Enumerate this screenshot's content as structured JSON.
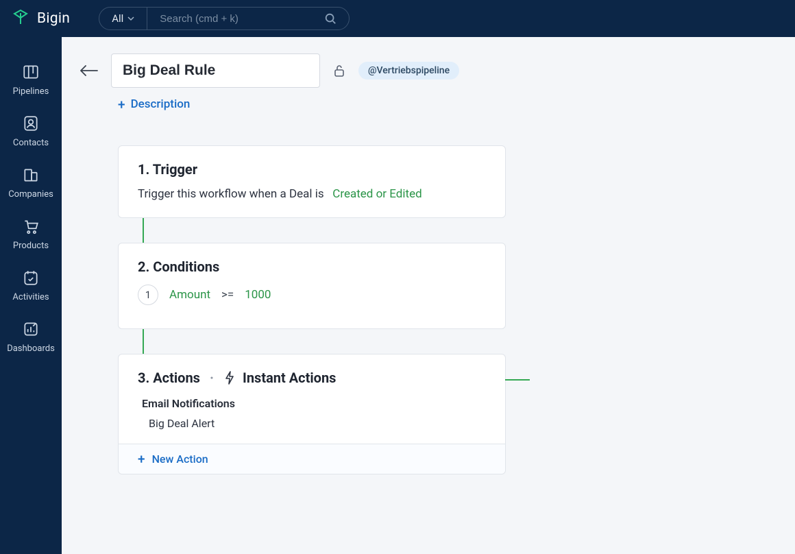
{
  "brand": "Bigin",
  "topbar": {
    "filter_label": "All",
    "search_placeholder": "Search (cmd + k)"
  },
  "sidebar": {
    "items": [
      {
        "label": "Pipelines"
      },
      {
        "label": "Contacts"
      },
      {
        "label": "Companies"
      },
      {
        "label": "Products"
      },
      {
        "label": "Activities"
      },
      {
        "label": "Dashboards"
      }
    ]
  },
  "rule": {
    "title": "Big Deal Rule",
    "pipeline_tag": "@Vertriebspipeline",
    "add_description_label": "Description"
  },
  "trigger": {
    "title": "1. Trigger",
    "prefix": "Trigger this workflow when a Deal is",
    "mode": "Created or Edited"
  },
  "conditions": {
    "title": "2. Conditions",
    "rows": [
      {
        "index": "1",
        "field": "Amount",
        "operator": ">=",
        "value": "1000"
      }
    ]
  },
  "actions": {
    "title": "3.  Actions",
    "subtitle": "Instant Actions",
    "group_label": "Email Notifications",
    "items": [
      "Big Deal Alert"
    ],
    "new_action_label": "New Action"
  }
}
